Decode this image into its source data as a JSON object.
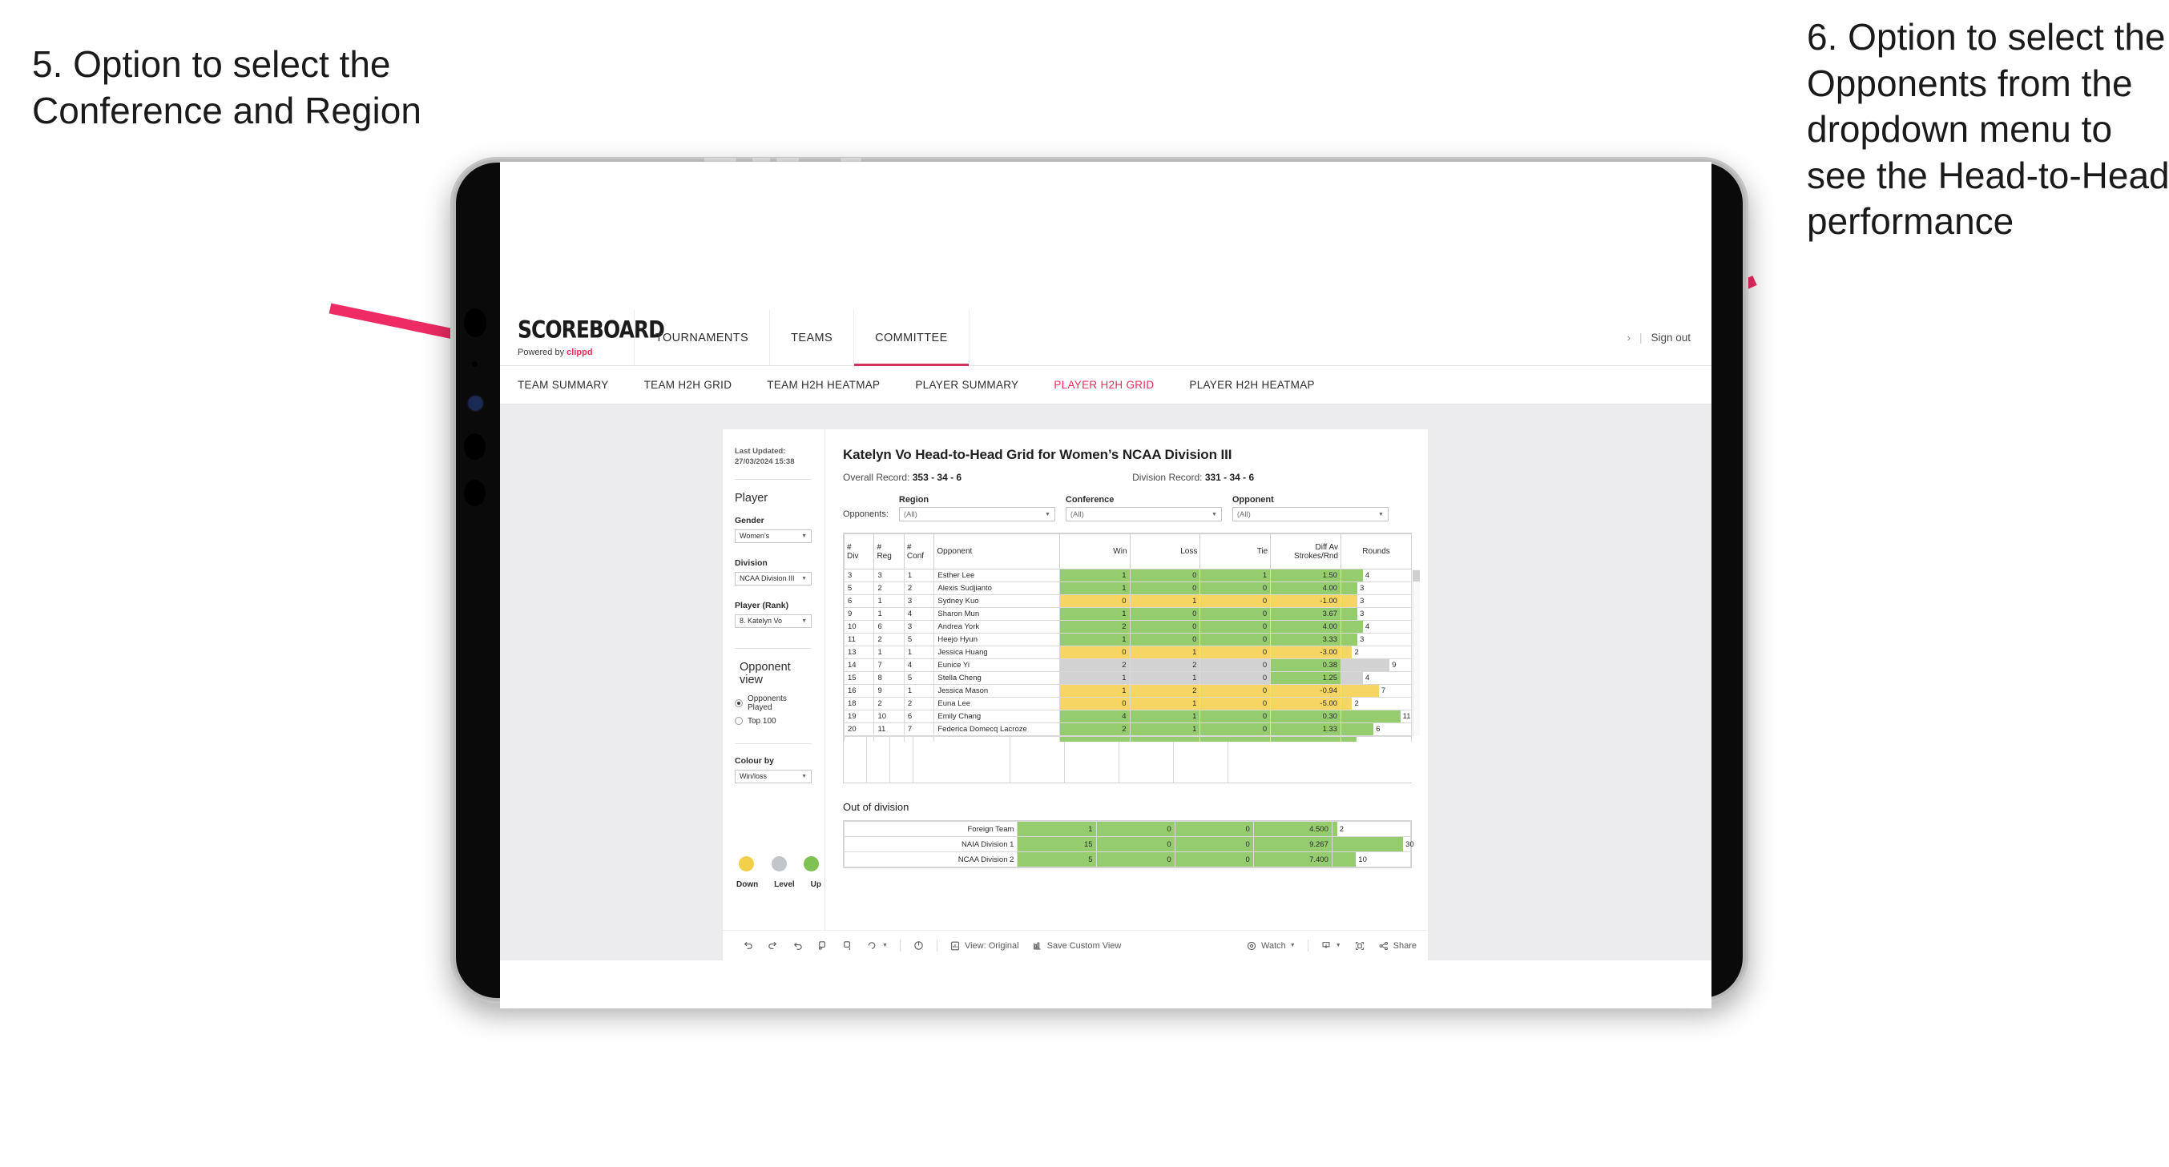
{
  "annotations": {
    "left": "5. Option to select the Conference and Region",
    "right": "6. Option to select the Opponents from the dropdown menu to see the Head-to-Head performance"
  },
  "app": {
    "logo": {
      "word": "SCOREBOARD",
      "powered_prefix": "Powered by ",
      "brand": "clippd"
    },
    "nav_tabs": [
      {
        "label": "TOURNAMENTS",
        "active": false
      },
      {
        "label": "TEAMS",
        "active": false
      },
      {
        "label": "COMMITTEE",
        "active": true
      }
    ],
    "nav_right": {
      "chevron": "›",
      "separator": "|",
      "sign_out": "Sign out"
    },
    "sub_tabs": [
      {
        "label": "TEAM SUMMARY",
        "active": false
      },
      {
        "label": "TEAM H2H GRID",
        "active": false
      },
      {
        "label": "TEAM H2H HEATMAP",
        "active": false
      },
      {
        "label": "PLAYER SUMMARY",
        "active": false
      },
      {
        "label": "PLAYER H2H GRID",
        "active": true
      },
      {
        "label": "PLAYER H2H HEATMAP",
        "active": false
      }
    ]
  },
  "sidebar": {
    "last_updated": "Last Updated: 27/03/2024 15:38",
    "player_heading": "Player",
    "fields": [
      {
        "label": "Gender",
        "value": "Women’s"
      },
      {
        "label": "Division",
        "value": "NCAA Division III"
      },
      {
        "label": "Player (Rank)",
        "value": "8. Katelyn Vo"
      }
    ],
    "opponent_view": {
      "heading": "Opponent view",
      "options": [
        {
          "label": "Opponents Played",
          "selected": true
        },
        {
          "label": "Top 100",
          "selected": false
        }
      ]
    },
    "colour_by": {
      "label": "Colour by",
      "value": "Win/loss"
    },
    "legend": [
      {
        "label": "Down",
        "color": "#f2d04b"
      },
      {
        "label": "Level",
        "color": "#c2c5c9"
      },
      {
        "label": "Up",
        "color": "#7ec254"
      }
    ]
  },
  "main": {
    "title": "Katelyn Vo Head-to-Head Grid for Women’s NCAA Division III",
    "overall_record_label": "Overall Record:",
    "overall_record_value": "353 - 34 - 6",
    "division_record_label": "Division Record:",
    "division_record_value": "331 - 34 - 6",
    "opponents_label": "Opponents:",
    "filters": [
      {
        "label": "Region",
        "value": "(All)"
      },
      {
        "label": "Conference",
        "value": "(All)"
      },
      {
        "label": "Opponent",
        "value": "(All)"
      }
    ],
    "out_of_division_heading": "Out of division"
  },
  "chart_data": {
    "type": "table",
    "title": "Katelyn Vo Head-to-Head Grid for Women’s NCAA Division III",
    "columns": [
      "# Div",
      "# Reg",
      "# Conf",
      "Opponent",
      "Win",
      "Loss",
      "Tie",
      "Diff Av Strokes/Rnd",
      "Rounds"
    ],
    "column_header_lines": [
      [
        "#",
        "Div"
      ],
      [
        "#",
        "Reg"
      ],
      [
        "#",
        "Conf"
      ],
      [
        "Opponent"
      ],
      [
        "Win"
      ],
      [
        "Loss"
      ],
      [
        "Tie"
      ],
      [
        "Diff Av",
        "Strokes/Rnd"
      ],
      [
        "Rounds"
      ]
    ],
    "rounds_axis_max": 13,
    "rows": [
      {
        "div": "3",
        "reg": "3",
        "conf": "1",
        "opponent": "Esther Lee",
        "win": "1",
        "loss": "0",
        "tie": "1",
        "diff": "1.50",
        "rounds": "4",
        "rounds_value": 4,
        "state": "up"
      },
      {
        "div": "5",
        "reg": "2",
        "conf": "2",
        "opponent": "Alexis Sudjianto",
        "win": "1",
        "loss": "0",
        "tie": "0",
        "diff": "4.00",
        "rounds": "3",
        "rounds_value": 3,
        "state": "up"
      },
      {
        "div": "6",
        "reg": "1",
        "conf": "3",
        "opponent": "Sydney Kuo",
        "win": "0",
        "loss": "1",
        "tie": "0",
        "diff": "-1.00",
        "rounds": "3",
        "rounds_value": 3,
        "state": "down"
      },
      {
        "div": "9",
        "reg": "1",
        "conf": "4",
        "opponent": "Sharon Mun",
        "win": "1",
        "loss": "0",
        "tie": "0",
        "diff": "3.67",
        "rounds": "3",
        "rounds_value": 3,
        "state": "up"
      },
      {
        "div": "10",
        "reg": "6",
        "conf": "3",
        "opponent": "Andrea York",
        "win": "2",
        "loss": "0",
        "tie": "0",
        "diff": "4.00",
        "rounds": "4",
        "rounds_value": 4,
        "state": "up"
      },
      {
        "div": "11",
        "reg": "2",
        "conf": "5",
        "opponent": "Heejo Hyun",
        "win": "1",
        "loss": "0",
        "tie": "0",
        "diff": "3.33",
        "rounds": "3",
        "rounds_value": 3,
        "state": "up"
      },
      {
        "div": "13",
        "reg": "1",
        "conf": "1",
        "opponent": "Jessica Huang",
        "win": "0",
        "loss": "1",
        "tie": "0",
        "diff": "-3.00",
        "rounds": "2",
        "rounds_value": 2,
        "state": "down"
      },
      {
        "div": "14",
        "reg": "7",
        "conf": "4",
        "opponent": "Eunice Yi",
        "win": "2",
        "loss": "2",
        "tie": "0",
        "diff": "0.38",
        "rounds": "9",
        "rounds_value": 9,
        "state": "level",
        "diff_state": "up"
      },
      {
        "div": "15",
        "reg": "8",
        "conf": "5",
        "opponent": "Stella Cheng",
        "win": "1",
        "loss": "1",
        "tie": "0",
        "diff": "1.25",
        "rounds": "4",
        "rounds_value": 4,
        "state": "level",
        "diff_state": "up"
      },
      {
        "div": "16",
        "reg": "9",
        "conf": "1",
        "opponent": "Jessica Mason",
        "win": "1",
        "loss": "2",
        "tie": "0",
        "diff": "-0.94",
        "rounds": "7",
        "rounds_value": 7,
        "state": "down"
      },
      {
        "div": "18",
        "reg": "2",
        "conf": "2",
        "opponent": "Euna Lee",
        "win": "0",
        "loss": "1",
        "tie": "0",
        "diff": "-5.00",
        "rounds": "2",
        "rounds_value": 2,
        "state": "down"
      },
      {
        "div": "19",
        "reg": "10",
        "conf": "6",
        "opponent": "Emily Chang",
        "win": "4",
        "loss": "1",
        "tie": "0",
        "diff": "0.30",
        "rounds": "11",
        "rounds_value": 11,
        "state": "up"
      },
      {
        "div": "20",
        "reg": "11",
        "conf": "7",
        "opponent": "Federica Domecq Lacroze",
        "win": "2",
        "loss": "1",
        "tie": "0",
        "diff": "1.33",
        "rounds": "6",
        "rounds_value": 6,
        "state": "up"
      }
    ],
    "out_of_division": {
      "heading": "Out of division",
      "rounds_axis_max": 33,
      "rows": [
        {
          "name": "Foreign Team",
          "win": "1",
          "loss": "0",
          "tie": "0",
          "diff": "4.500",
          "rounds": "2",
          "rounds_value": 2,
          "state": "up"
        },
        {
          "name": "NAIA Division 1",
          "win": "15",
          "loss": "0",
          "tie": "0",
          "diff": "9.267",
          "rounds": "30",
          "rounds_value": 30,
          "state": "up"
        },
        {
          "name": "NCAA Division 2",
          "win": "5",
          "loss": "0",
          "tie": "0",
          "diff": "7.400",
          "rounds": "10",
          "rounds_value": 10,
          "state": "up"
        }
      ]
    },
    "colors": {
      "up": "#94cc6e",
      "down": "#f7d562",
      "level": "#d2d2d2"
    }
  },
  "toolbar": {
    "view_original": "View: Original",
    "save_custom_view": "Save Custom View",
    "watch": "Watch",
    "share": "Share"
  }
}
